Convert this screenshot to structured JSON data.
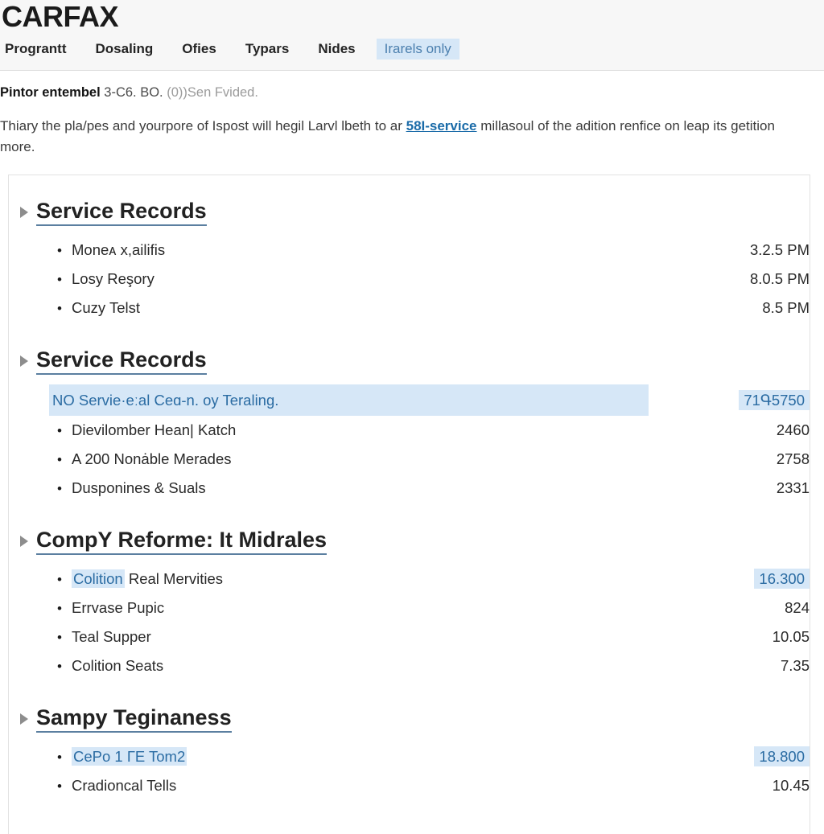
{
  "header": {
    "brand": "CARFAX",
    "nav": [
      {
        "label": "Prograntt",
        "highlight": false
      },
      {
        "label": "Dosaling",
        "highlight": false
      },
      {
        "label": "Ofies",
        "highlight": false
      },
      {
        "label": "Typars",
        "highlight": false
      },
      {
        "label": "Nides",
        "highlight": false
      },
      {
        "label": "Irarels only",
        "highlight": true
      }
    ]
  },
  "intro": {
    "lead": "Pintor entembel",
    "detail": "3-C6. BO.",
    "faded": "(0))Sen Fvided.",
    "paragraph_before": "Thiary the pla/pes and yourpore of Ispost will hegil Larvl lbeth to ar ",
    "paragraph_link": "58I-service",
    "paragraph_after": " millasoul of the adition renfice on leap its getition more."
  },
  "sections": [
    {
      "title": "Service Records",
      "rows": [
        {
          "label": "Moneᴀ x,ailifis",
          "value": "3.2.5 PM",
          "label_highlight": false,
          "value_highlight": false,
          "headline": false
        },
        {
          "label": "Losy Reşory",
          "value": "8.0.5 PM",
          "label_highlight": false,
          "value_highlight": false,
          "headline": false
        },
        {
          "label": "Cuzy Telst",
          "value": "8.5 PM",
          "label_highlight": false,
          "value_highlight": false,
          "headline": false
        }
      ]
    },
    {
      "title": "Service Records",
      "rows": [
        {
          "label": "NO Servie·eːal Ceɑ-n. oy Teraling.",
          "value": "71Գ5750",
          "label_highlight": true,
          "value_highlight": true,
          "headline": true
        },
        {
          "label": "Dievilomber Hean| Katch",
          "value": "2460",
          "label_highlight": false,
          "value_highlight": false,
          "headline": false
        },
        {
          "label": "A 200 Nonȧble Merades",
          "value": "2758",
          "label_highlight": false,
          "value_highlight": false,
          "headline": false
        },
        {
          "label": "Dusponines & Suals",
          "value": "2331",
          "label_highlight": false,
          "value_highlight": false,
          "headline": false
        }
      ]
    },
    {
      "title": "CompY Reforme: It Midrales",
      "rows": [
        {
          "label_hl": "Colition",
          "label": " Real Mervities",
          "value": "16.300",
          "label_highlight": true,
          "value_highlight": true,
          "headline": false
        },
        {
          "label": "Errvase Pupic",
          "value": "824",
          "label_highlight": false,
          "value_highlight": false,
          "headline": false
        },
        {
          "label": "Teal Supper",
          "value": "10.05",
          "label_highlight": false,
          "value_highlight": false,
          "headline": false
        },
        {
          "label": "Colition Seats",
          "value": "7.35",
          "label_highlight": false,
          "value_highlight": false,
          "headline": false
        }
      ]
    },
    {
      "title": "Sampy Teginaness",
      "rows": [
        {
          "label": "CePo 1 ГE Tom2",
          "value": "18.800",
          "label_highlight": true,
          "value_highlight": true,
          "headline": false
        },
        {
          "label": "Cradionсal Tells",
          "value": "10.45",
          "label_highlight": false,
          "value_highlight": false,
          "headline": false
        }
      ]
    }
  ],
  "colors": {
    "highlight_bg": "#d6e7f7",
    "highlight_text": "#2b6ca3",
    "link": "#1a6ba8",
    "header_bg": "#f7f7f7",
    "rule": "#5b7fa0"
  }
}
